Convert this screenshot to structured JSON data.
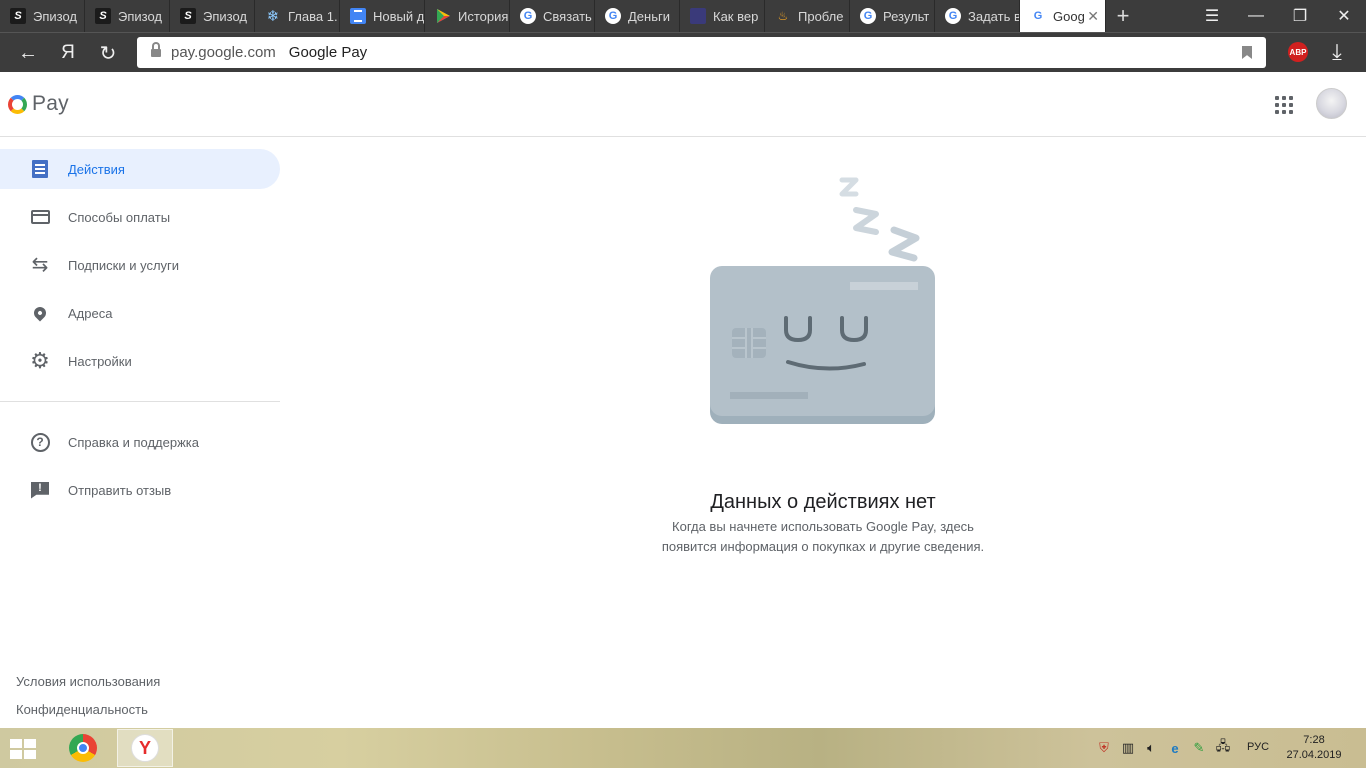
{
  "browser": {
    "tabs": [
      {
        "title": "Эпизод",
        "icon": "s-logo-icon",
        "active": false
      },
      {
        "title": "Эпизод",
        "icon": "s-logo-icon",
        "active": false
      },
      {
        "title": "Эпизод",
        "icon": "s-logo-icon",
        "active": false
      },
      {
        "title": "Глава 1.",
        "icon": "snowflake-icon",
        "active": false
      },
      {
        "title": "Новый д",
        "icon": "docs-icon",
        "active": false
      },
      {
        "title": "История",
        "icon": "play-icon",
        "active": false
      },
      {
        "title": "Связать",
        "icon": "google-icon",
        "active": false
      },
      {
        "title": "Деньги",
        "icon": "google-icon",
        "active": false
      },
      {
        "title": "Как вер",
        "icon": "anime-icon",
        "active": false
      },
      {
        "title": "Пробле",
        "icon": "fire-icon",
        "active": false
      },
      {
        "title": "Результ",
        "icon": "google-icon",
        "active": false
      },
      {
        "title": "Задать в",
        "icon": "google-icon",
        "active": false
      },
      {
        "title": "Goog",
        "icon": "google-icon",
        "active": true
      }
    ],
    "address": {
      "domain": "pay.google.com",
      "page_title": "Google Pay"
    },
    "yandex_button": "Я",
    "abp_label": "ABP"
  },
  "header": {
    "logo_text": "Pay"
  },
  "sidebar": {
    "items": [
      {
        "label": "Действия",
        "icon": "activity-list-icon",
        "active": true
      },
      {
        "label": "Способы оплаты",
        "icon": "credit-card-icon",
        "active": false
      },
      {
        "label": "Подписки и услуги",
        "icon": "repeat-icon",
        "active": false
      },
      {
        "label": "Адреса",
        "icon": "location-pin-icon",
        "active": false
      },
      {
        "label": "Настройки",
        "icon": "gear-icon",
        "active": false
      }
    ],
    "secondary": [
      {
        "label": "Справка и поддержка",
        "icon": "help-icon"
      },
      {
        "label": "Отправить отзыв",
        "icon": "feedback-icon"
      }
    ],
    "footer": {
      "terms": "Условия использования",
      "privacy": "Конфиденциальность"
    }
  },
  "main": {
    "empty_title": "Данных о действиях нет",
    "empty_description": "Когда вы начнете использовать Google Pay, здесь появится информация о покупках и другие сведения.",
    "illustration": "sleeping-card-illustration"
  },
  "taskbar": {
    "language": "РУС",
    "time": "7:28",
    "date": "27.04.2019",
    "yandex_icon_letter": "Y"
  },
  "colors": {
    "accent": "#1a73e8",
    "active_bg": "#e8f0fe",
    "card": "#b3c0c9"
  }
}
